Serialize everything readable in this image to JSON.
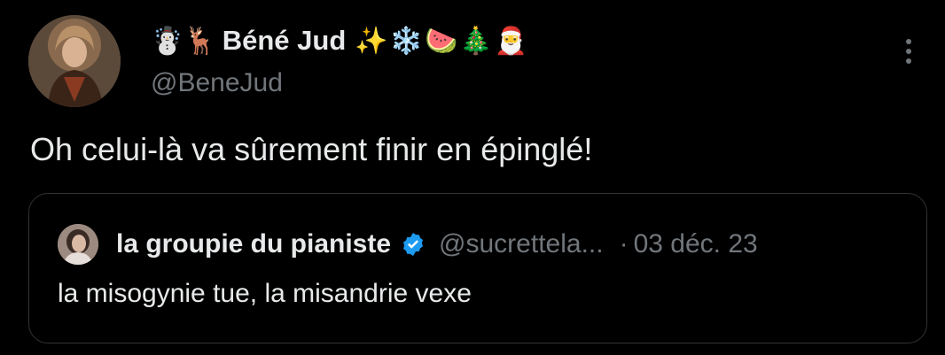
{
  "colors": {
    "background": "#000000",
    "text_primary": "#e7e9ea",
    "text_secondary": "#71767b",
    "border": "#2f3336",
    "verified_blue": "#1d9bf0"
  },
  "author": {
    "emoji_lead": "☃️🦌",
    "display_name": "Béné Jud",
    "emoji_trail": "✨❄️🍉🎄🎅",
    "handle": "@BeneJud",
    "avatar_icon": "user-avatar-photo"
  },
  "more_icon": "more-options-icon",
  "tweet": {
    "text": "Oh celui-là va sûrement finir en épinglé!"
  },
  "quoted": {
    "avatar_icon": "user-avatar-photo",
    "display_name": "la groupie du pianiste",
    "verified_icon": "verified-badge-icon",
    "handle": "@sucrettela...",
    "separator": "·",
    "date": "03 déc. 23",
    "text": "la misogynie tue, la misandrie vexe"
  }
}
